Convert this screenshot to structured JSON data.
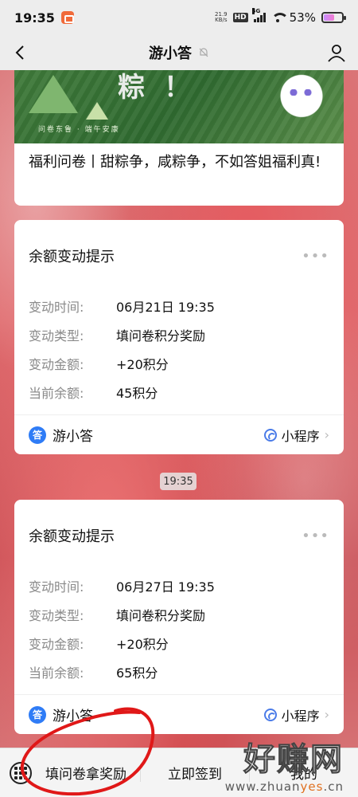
{
  "status_bar": {
    "time": "19:35",
    "net_speed_value": "21.9",
    "net_speed_unit": "KB/s",
    "hd": "HD",
    "signal_label": "5G",
    "battery_percent": "53%",
    "battery_level": 0.53
  },
  "header": {
    "title": "游小答"
  },
  "banner": {
    "big_text": "粽！",
    "caption": "问卷东鲁 · 端午安康",
    "text": "福利问卷丨甜粽争，咸粽争，不如答姐福利真!"
  },
  "messages": [
    {
      "title": "余额变动提示",
      "rows": [
        {
          "label": "变动时间:",
          "value": "06月21日 19:35"
        },
        {
          "label": "变动类型:",
          "value": "填问卷积分奖励"
        },
        {
          "label": "变动金额:",
          "value": "+20积分"
        },
        {
          "label": "当前余额:",
          "value": "45积分"
        }
      ],
      "app_logo": "答",
      "app_name": "游小答",
      "mini_program": "小程序"
    },
    {
      "title": "余额变动提示",
      "rows": [
        {
          "label": "变动时间:",
          "value": "06月27日 19:35"
        },
        {
          "label": "变动类型:",
          "value": "填问卷积分奖励"
        },
        {
          "label": "变动金额:",
          "value": "+20积分"
        },
        {
          "label": "当前余额:",
          "value": "65积分"
        }
      ],
      "app_logo": "答",
      "app_name": "游小答",
      "mini_program": "小程序"
    }
  ],
  "time_divider": "19:35",
  "bottom_menu": {
    "items": [
      "填问卷拿奖励",
      "立即签到",
      "我的"
    ]
  },
  "watermark": {
    "title": "好赚网",
    "url_prefix": "www.zhuan",
    "url_highlight": "yes",
    "url_suffix": ".cn"
  },
  "colors": {
    "accent_blue": "#2f7cf6",
    "annotation_red": "#e01818",
    "battery_fill": "#d27be6"
  }
}
